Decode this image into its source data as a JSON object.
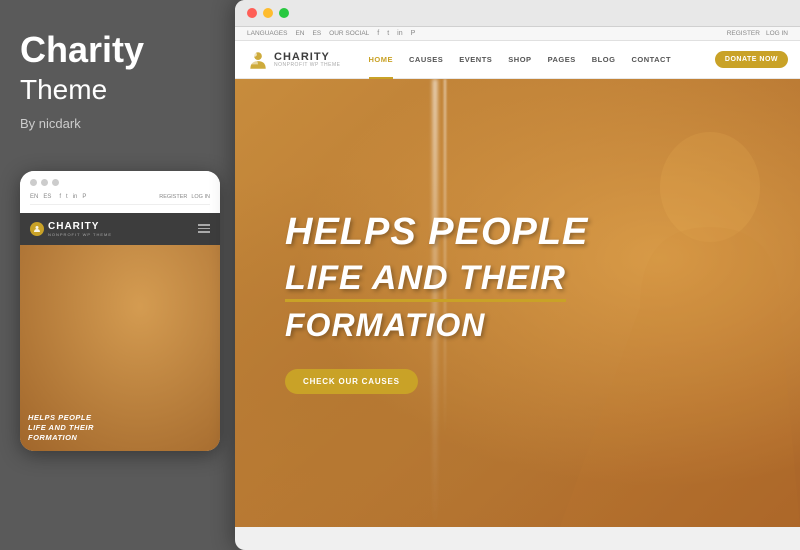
{
  "left": {
    "title": "Charity",
    "subtitle": "Theme",
    "author": "By nicdark"
  },
  "mobile": {
    "social_items": [
      "EN",
      "ES"
    ],
    "auth_items": [
      "REGISTER",
      "LOG IN"
    ],
    "logo": "CHARITY",
    "logo_sub": "NONPROFIT WP THEME",
    "hero_text": "HELPS PEOPLE\nLIFE AND THEIR\nFORMATION"
  },
  "desktop": {
    "top_bar": {
      "languages": "LANGUAGES",
      "lang_en": "EN",
      "lang_es": "ES",
      "our_social": "OUR SOCIAL",
      "register": "REGISTER",
      "login": "LOG IN"
    },
    "nav": {
      "logo": "CHARITY",
      "logo_sub": "NONPROFIT WP THEME",
      "items": [
        "HOME",
        "CAUSES",
        "EVENTS",
        "SHOP",
        "PAGES",
        "BLOG",
        "CONTACT"
      ],
      "active": "HOME",
      "donate_btn": "DONATE NOW"
    },
    "hero": {
      "line1": "HELPS PEOPLE",
      "line2": "LIFE AND THEIR",
      "line3": "FORMATION",
      "cta": "CHECK OUR CAUSES"
    }
  }
}
